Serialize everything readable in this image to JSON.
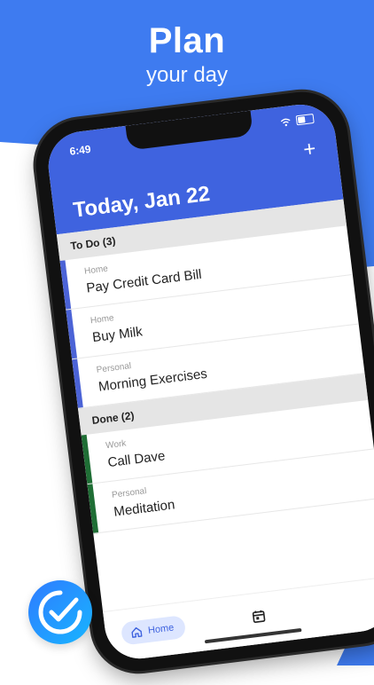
{
  "hero": {
    "title": "Plan",
    "subtitle": "your day"
  },
  "colors": {
    "hero_blue": "#3E7BF0",
    "app_header_blue": "#3f63df",
    "todo_strip": "#4b63d6",
    "done_strip": "#1f6e35",
    "section_gray": "#e5e5e5"
  },
  "status_bar": {
    "time": "6:49"
  },
  "app": {
    "header_title": "Today,  Jan 22",
    "add_icon": "+",
    "sections": [
      {
        "label": "To Do (3)",
        "items": [
          {
            "category": "Home",
            "title": "Pay Credit Card Bill"
          },
          {
            "category": "Home",
            "title": "Buy Milk"
          },
          {
            "category": "Personal",
            "title": "Morning Exercises"
          }
        ]
      },
      {
        "label": "Done (2)",
        "items": [
          {
            "category": "Work",
            "title": "Call Dave"
          },
          {
            "category": "Personal",
            "title": "Meditation"
          }
        ]
      }
    ],
    "nav": {
      "home_label": "Home",
      "home_icon": "home-icon",
      "calendar_icon": "calendar-icon",
      "settings_icon": "gear-icon"
    }
  },
  "badge": {
    "icon": "checkmark-circle-icon"
  }
}
